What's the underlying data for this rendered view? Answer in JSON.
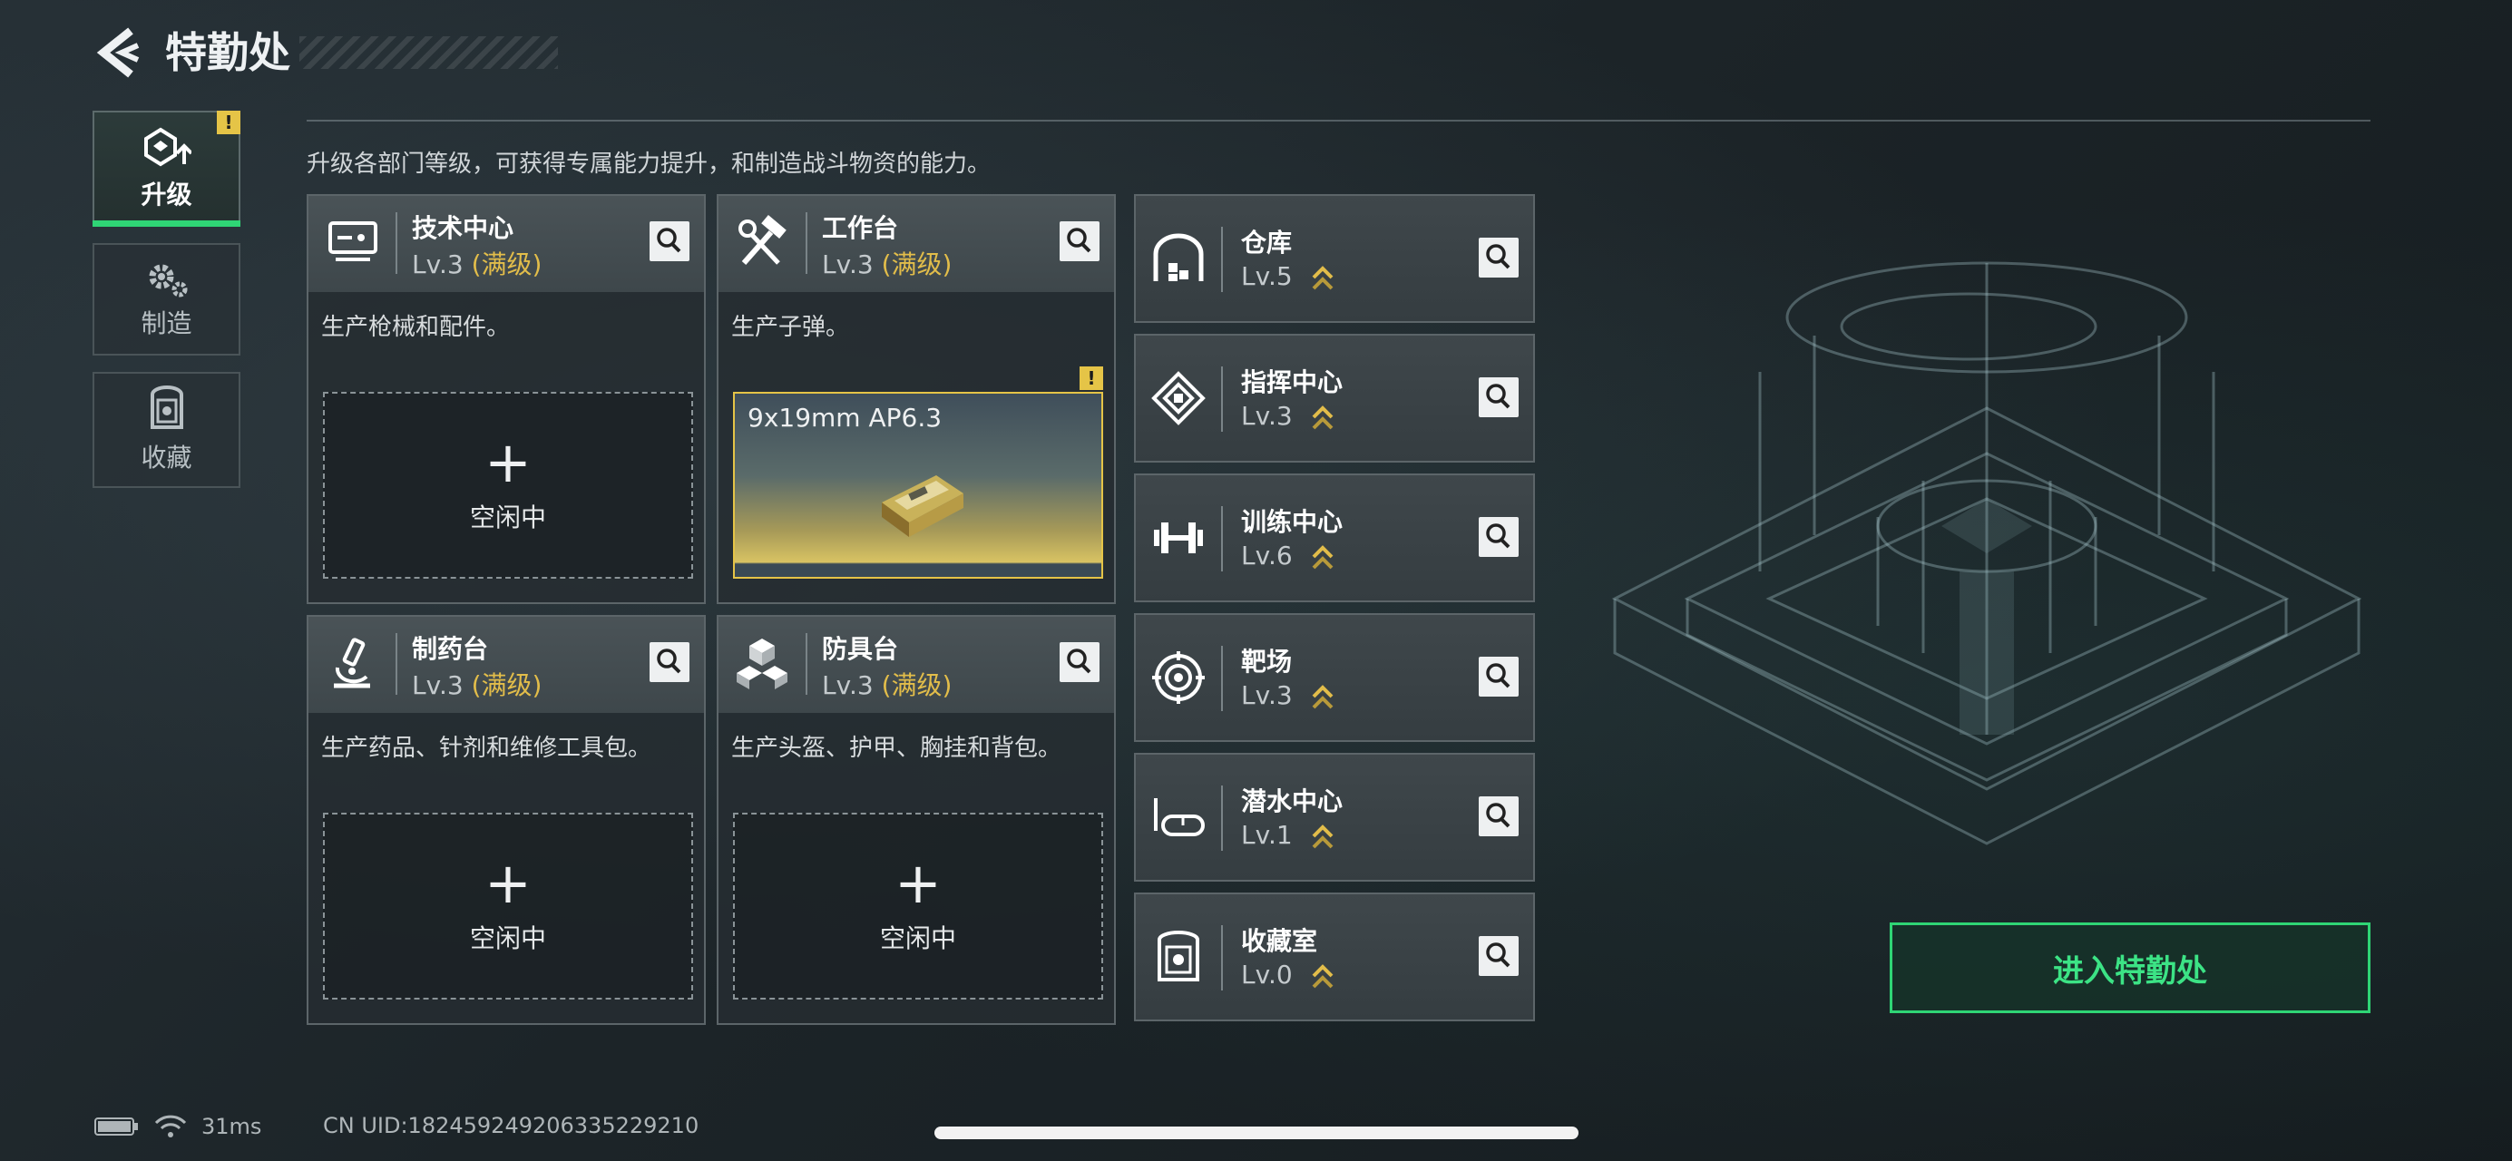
{
  "header": {
    "title": "特勤处"
  },
  "side_tabs": [
    {
      "label": "升级",
      "icon": "upgrade-icon",
      "active": true,
      "badge": "!"
    },
    {
      "label": "制造",
      "icon": "gear-icon",
      "active": false
    },
    {
      "label": "收藏",
      "icon": "collection-icon",
      "active": false
    }
  ],
  "description": "升级各部门等级，可获得专属能力提升，和制造战斗物资的能力。",
  "stations": [
    {
      "name": "技术中心",
      "level": "Lv.3",
      "max": "(满级)",
      "desc": "生产枪械和配件。",
      "icon": "monitor-icon",
      "slot": {
        "plus": "+",
        "status": "空闲中"
      }
    },
    {
      "name": "工作台",
      "level": "Lv.3",
      "max": "(满级)",
      "desc": "生产子弹。",
      "icon": "tools-icon",
      "slot": {
        "item": "9x19mm AP6.3",
        "badge": "!"
      }
    },
    {
      "name": "制药台",
      "level": "Lv.3",
      "max": "(满级)",
      "desc": "生产药品、针剂和维修工具包。",
      "icon": "microscope-icon",
      "slot": {
        "plus": "+",
        "status": "空闲中"
      }
    },
    {
      "name": "防具台",
      "level": "Lv.3",
      "max": "(满级)",
      "desc": "生产头盔、护甲、胸挂和背包。",
      "icon": "blocks-icon",
      "slot": {
        "plus": "+",
        "status": "空闲中"
      }
    }
  ],
  "facilities": [
    {
      "name": "仓库",
      "level": "Lv.5",
      "icon": "warehouse-icon"
    },
    {
      "name": "指挥中心",
      "level": "Lv.3",
      "icon": "command-icon"
    },
    {
      "name": "训练中心",
      "level": "Lv.6",
      "icon": "dumbbell-icon"
    },
    {
      "name": "靶场",
      "level": "Lv.3",
      "icon": "target-icon"
    },
    {
      "name": "潜水中心",
      "level": "Lv.1",
      "icon": "diving-mask-icon"
    },
    {
      "name": "收藏室",
      "level": "Lv.0",
      "icon": "collection-room-icon"
    }
  ],
  "enter_button": "进入特勤处",
  "status_bar": {
    "ping": "31ms",
    "uid": "CN UID:18245924920633522921​0"
  },
  "colors": {
    "accent": "#2fd575",
    "max_level": "#e2bd4a",
    "warning": "#e5c447"
  }
}
